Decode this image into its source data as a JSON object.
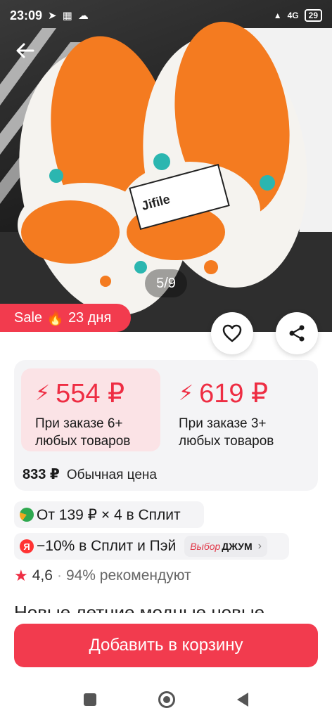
{
  "status_bar": {
    "time": "23:09",
    "network": "4G",
    "battery": "29"
  },
  "gallery": {
    "counter": "5/9"
  },
  "sale_badge": {
    "label": "Sale",
    "days": "23 дня"
  },
  "prices": {
    "tiers": [
      {
        "price": "554 ₽",
        "condition_line1": "При заказе 6+",
        "condition_line2": "любых товаров"
      },
      {
        "price": "619 ₽",
        "condition_line1": "При заказе 3+",
        "condition_line2": "любых товаров"
      }
    ],
    "regular_price": "833 ₽",
    "regular_label": "Обычная цена"
  },
  "payment": {
    "split_text": "От 139 ₽ × 4 в Сплит",
    "discount_text": "−10% в Сплит и Пэй",
    "brand_vybor": "Выбор",
    "brand_name": "ДЖУМ",
    "ya_letter": "Я"
  },
  "rating": {
    "value": "4,6",
    "recommend": "94% рекомендуют"
  },
  "title_peek": "Новые летние модные новые",
  "cart_button": "Добавить в корзину",
  "colors": {
    "accent": "#f23b4e",
    "price_red": "#ee2d43",
    "card_bg": "#f4f4f6",
    "active_tier_bg": "#fbe3e6"
  },
  "icons": {
    "back": "arrow-left-icon",
    "favorite": "heart-icon",
    "share": "share-icon",
    "fire": "fire-icon",
    "bolt": "lightning-icon",
    "star": "star-icon"
  }
}
